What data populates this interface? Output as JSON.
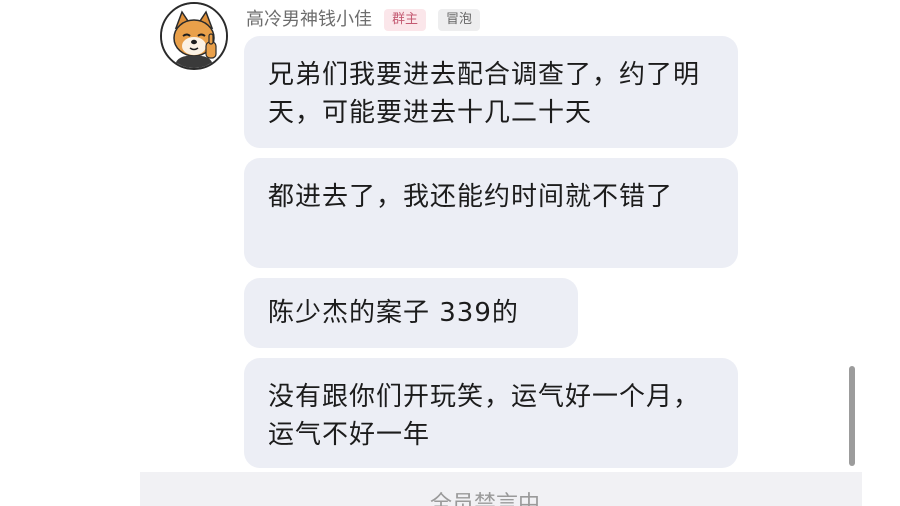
{
  "chat": {
    "sender": {
      "name": "高冷男神钱小佳",
      "role_badge": "群主",
      "level_badge": "冒泡",
      "avatar_icon": "shiba-dog-avatar-icon"
    },
    "messages": [
      {
        "text": "兄弟们我要进去配合调查了，约了明天，可能要进去十几二十天"
      },
      {
        "text": "都进去了，我还能约时间就不错了"
      },
      {
        "text": "陈少杰的案子 339的"
      },
      {
        "text": "没有跟你们开玩笑，运气好一个月，运气不好一年"
      }
    ]
  },
  "input_bar": {
    "placeholder": "全员禁言中"
  },
  "colors": {
    "bubble_bg": "#eceef5",
    "owner_badge_bg": "#fbe6ea",
    "owner_badge_text": "#c45a72",
    "level_badge_bg": "#eeeeef",
    "scrollbar": "#9c9c9c"
  }
}
